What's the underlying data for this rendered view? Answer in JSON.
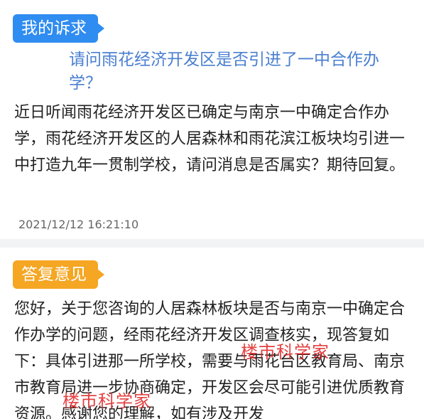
{
  "petition": {
    "tag_label": "我的诉求",
    "question": "请问雨花经济开发区是否引进了一中合作办学？",
    "body": "近日听闻雨花经济开发区已确定与南京一中确定合作办学，雨花经济开发区的人居森林和雨花滨江板块均引进一中打造九年一贯制学校，请问消息是否属实？期待回复。",
    "timestamp": "2021/12/12 16:21:10"
  },
  "reply": {
    "tag_label": "答复意见",
    "body": "您好，关于您咨询的人居森林板块是否与南京一中确定合作办学的问题，经雨花经济开发区调查核实，现答复如下：具体引进那一所学校，需要与雨花台区教育局、南京市教育局进一步协商确定，开发区会尽可能引进优质教育资源。感谢您的理解，如有涉及开发"
  },
  "watermarks": [
    "楼市科学家",
    "楼市科学家"
  ],
  "colors": {
    "petition_tag": "#2f8cf0",
    "reply_tag": "#f5a623",
    "question_text": "#4a7fd0",
    "watermark": "#e02020"
  }
}
